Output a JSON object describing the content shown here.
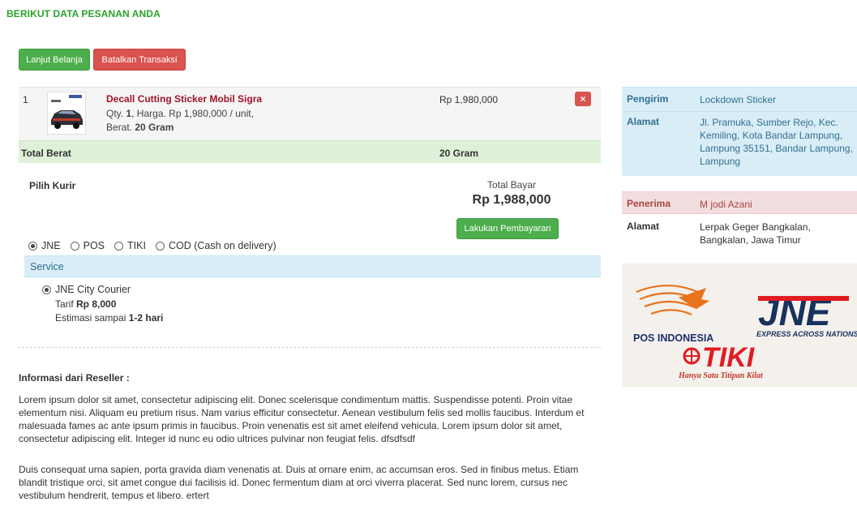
{
  "page_title": "BERIKUT DATA PESANAN ANDA",
  "buttons": {
    "continue": "Lanjut Belanja",
    "cancel": "Batalkan Transaksi",
    "pay": "Lakukan Pembayaran",
    "delete_icon": "×"
  },
  "item": {
    "no": "1",
    "title": "Decall Cutting Sticker Mobil Sigra",
    "qty_prefix": "Qty. ",
    "qty": "1",
    "qty_suffix": ", Harga. Rp 1,980,000 / unit,",
    "weight_prefix": "Berat. ",
    "weight": "20 Gram",
    "price": "Rp 1,980,000",
    "thumb_icon": "car-thumbnail"
  },
  "total": {
    "label": "Total Berat",
    "value": "20 Gram"
  },
  "courier": {
    "label": "Pilih Kurir",
    "options": [
      "JNE",
      "POS",
      "TIKI",
      "COD (Cash on delivery)"
    ],
    "selected": "JNE",
    "service_header": "Service",
    "service_name": "JNE City Courier",
    "tarif_prefix": "Tarif ",
    "tarif": "Rp 8,000",
    "estimasi_prefix": "Estimasi sampai ",
    "estimasi": "1-2 hari"
  },
  "payment": {
    "label": "Total Bayar",
    "value": "Rp 1,988,000"
  },
  "reseller": {
    "title": "Informasi dari Reseller :",
    "para1": "Lorem ipsum dolor sit amet, consectetur adipiscing elit. Donec scelerisque condimentum mattis. Suspendisse potenti. Proin vitae elementum nisi. Aliquam eu pretium risus. Nam varius efficitur consectetur. Aenean vestibulum felis sed mollis faucibus. Interdum et malesuada fames ac ante ipsum primis in faucibus. Proin venenatis est sit amet eleifend vehicula. Lorem ipsum dolor sit amet, consectetur adipiscing elit. Integer id nunc eu odio ultrices pulvinar non feugiat felis.  dfsdfsdf",
    "para2": "Duis consequat urna sapien, porta gravida diam venenatis at. Duis at ornare enim, ac accumsan eros. Sed in finibus metus. Etiam blandit tristique orci, sit amet congue dui facilisis id. Donec fermentum diam at orci viverra placerat. Sed nunc lorem, cursus nec vestibulum hendrerit, tempus et libero. ertert"
  },
  "sender": {
    "label": "Pengirim",
    "name": "Lockdown Sticker",
    "address_label": "Alamat",
    "address": "Jl. Pramuka, Sumber Rejo, Kec. Kemiling, Kota Bandar Lampung, Lampung 35151, Bandar Lampung, Lampung"
  },
  "receiver": {
    "label": "Penerima",
    "name": "M jodi Azani",
    "address_label": "Alamat",
    "address": "Lerpak Geger Bangkalan, Bangkalan, Jawa Timur"
  },
  "logos": {
    "pos": "POS INDONESIA",
    "jne": "JNE",
    "jne_tagline": "EXPRESS ACROSS NATIONS",
    "tiki": "TIKI",
    "tiki_tagline": "Hanya Satu Titipan Kilat"
  },
  "colors": {
    "accent_green": "#2aa12a",
    "btn_success": "#4cae4c",
    "btn_danger": "#d9534f",
    "product_title": "#a0132a",
    "info_bg": "#d9edf7",
    "danger_bg": "#f2dede",
    "success_bg": "#dff0d8"
  }
}
